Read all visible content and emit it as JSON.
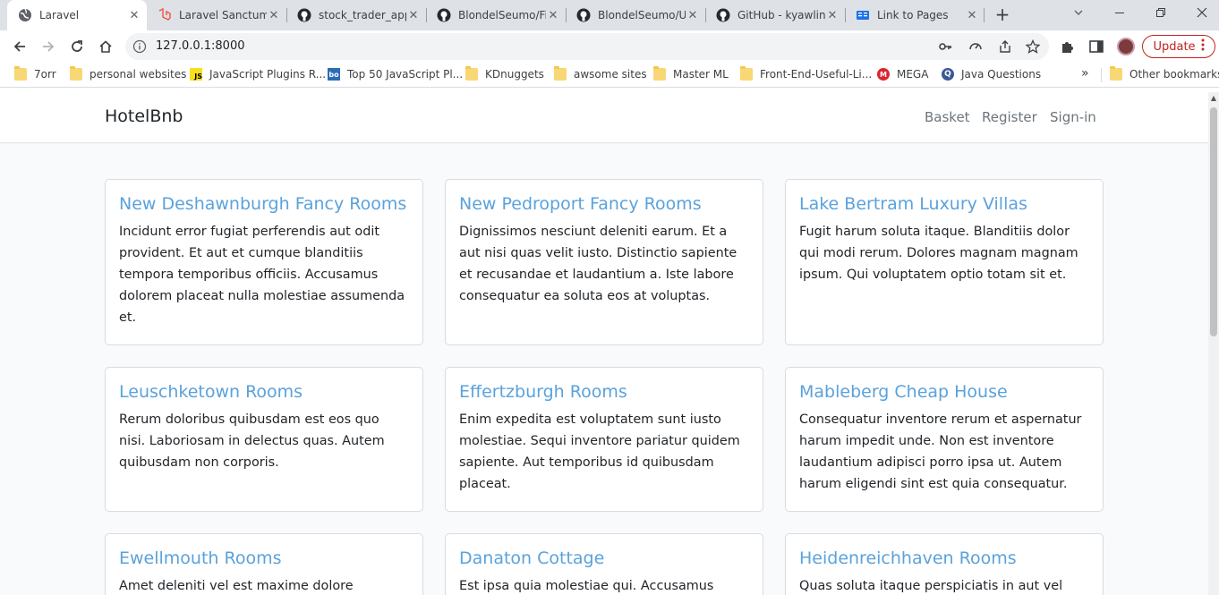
{
  "browser": {
    "tabs": [
      {
        "title": "Laravel",
        "active": true
      },
      {
        "title": "Laravel Sanctum",
        "active": false
      },
      {
        "title": "stock_trader_app",
        "active": false
      },
      {
        "title": "BlondelSeumo/Fi",
        "active": false
      },
      {
        "title": "BlondelSeumo/U",
        "active": false
      },
      {
        "title": "GitHub - kyawlin",
        "active": false
      },
      {
        "title": "Link to Pages",
        "active": false
      }
    ],
    "new_tab_label": "+",
    "url": "127.0.0.1:8000",
    "update_label": "Update",
    "bookmarks": [
      {
        "label": "7orr",
        "icon": "folder-icon"
      },
      {
        "label": "personal websites",
        "icon": "folder-icon"
      },
      {
        "label": "JavaScript Plugins R...",
        "icon": "js-icon"
      },
      {
        "label": "Top 50 JavaScript Pl...",
        "icon": "bo-icon"
      },
      {
        "label": "KDnuggets",
        "icon": "folder-icon"
      },
      {
        "label": "awsome sites",
        "icon": "folder-icon"
      },
      {
        "label": "Master ML",
        "icon": "folder-icon"
      },
      {
        "label": "Front-End-Useful-Li...",
        "icon": "folder-icon"
      },
      {
        "label": "MEGA",
        "icon": "mega-icon"
      },
      {
        "label": "Java Questions",
        "icon": "q-icon"
      }
    ],
    "bookmarks_overflow": "»",
    "other_bookmarks": "Other bookmarks"
  },
  "site": {
    "brand": "HotelBnb",
    "nav": [
      "Basket",
      "Register",
      "Sign-in"
    ]
  },
  "cards": [
    {
      "title": "New Deshawnburgh Fancy Rooms",
      "text": "Incidunt error fugiat perferendis aut odit provident. Et aut et cumque blanditiis tempora temporibus officiis. Accusamus dolorem placeat nulla molestiae assumenda et."
    },
    {
      "title": "New Pedroport Fancy Rooms",
      "text": "Dignissimos nesciunt deleniti earum. Et a aut nisi quas velit iusto. Distinctio sapiente et recusandae et laudantium a. Iste labore consequatur ea soluta eos at voluptas."
    },
    {
      "title": "Lake Bertram Luxury Villas",
      "text": "Fugit harum soluta itaque. Blanditiis dolor qui modi rerum. Dolores magnam magnam ipsum. Qui voluptatem optio totam sit et."
    },
    {
      "title": "Leuschketown Rooms",
      "text": "Rerum doloribus quibusdam est eos quo nisi. Laboriosam in delectus quas. Autem quibusdam non corporis."
    },
    {
      "title": "Effertzburgh Rooms",
      "text": "Enim expedita est voluptatem sunt iusto molestiae. Sequi inventore pariatur quidem sapiente. Aut temporibus id quibusdam placeat."
    },
    {
      "title": "Mableberg Cheap House",
      "text": "Consequatur inventore rerum et aspernatur harum impedit unde. Non est inventore laudantium adipisci porro ipsa ut. Autem harum eligendi sint est quia consequatur."
    },
    {
      "title": "Ewellmouth Rooms",
      "text": "Amet deleniti vel est maxime dolore"
    },
    {
      "title": "Danaton Cottage",
      "text": "Est ipsa quia molestiae qui. Accusamus"
    },
    {
      "title": "Heidenreichhaven Rooms",
      "text": "Quas soluta itaque perspiciatis in aut vel"
    }
  ]
}
